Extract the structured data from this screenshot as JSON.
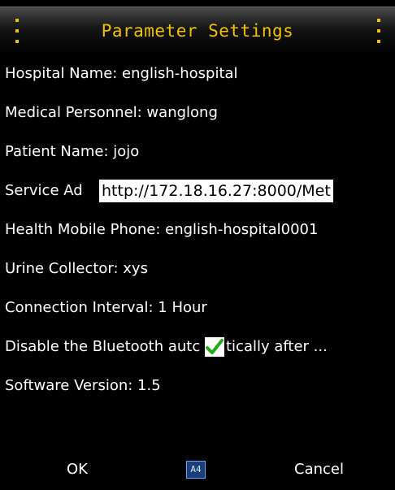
{
  "header": {
    "title": "Parameter Settings"
  },
  "colors": {
    "accent": "#f2c200",
    "background": "#000000",
    "text": "#ffffff",
    "check": "#21a91c"
  },
  "rows": [
    {
      "label": "Hospital Name: english-hospital"
    },
    {
      "label": "Medical Personnel: wanglong"
    },
    {
      "label": "Patient Name: jojo"
    },
    {
      "label": "Service Ad",
      "edit_value": "http://172.18.16.27:8000/Met"
    },
    {
      "label": "Health Mobile Phone: english-hospital0001"
    },
    {
      "label": "Urine Collector: xys"
    },
    {
      "label": "Connection Interval: 1 Hour"
    },
    {
      "label": "Disable the Bluetooth autc",
      "label_tail": "tically after ...",
      "checked": true,
      "check_icon": "checkmark-icon"
    },
    {
      "label": "Software Version: 1.5"
    }
  ],
  "footer": {
    "ok_label": "OK",
    "cancel_label": "Cancel",
    "ime_label": "A4",
    "ime_icon": "input-method-icon"
  }
}
